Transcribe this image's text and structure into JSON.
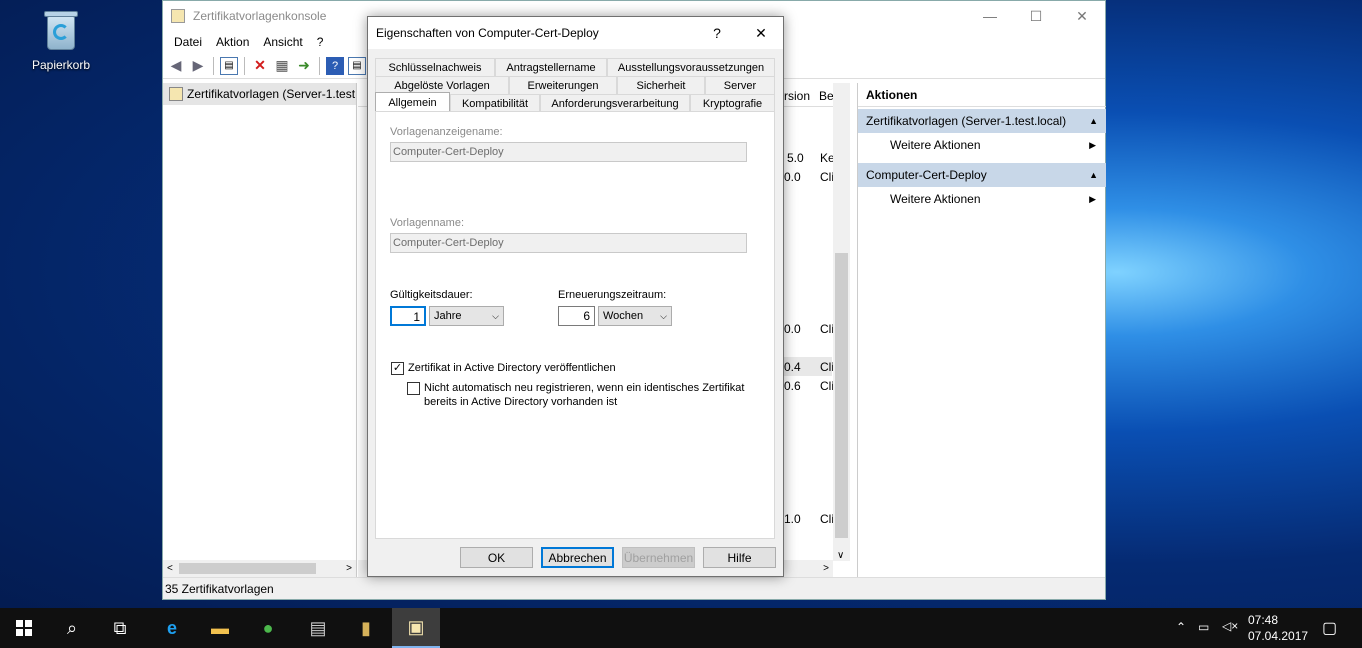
{
  "desktop": {
    "recycle_bin_label": "Papierkorb"
  },
  "console": {
    "title": "Zertifikatvorlagenkonsole",
    "window_buttons": {
      "minimize": "—",
      "maximize": "☐",
      "close": "✕"
    },
    "menu": [
      "Datei",
      "Aktion",
      "Ansicht",
      "?"
    ],
    "tree_node": "Zertifikatvorlagen (Server-1.test.local)",
    "list_headers": {
      "version": "rsion",
      "purpose": "Be"
    },
    "list_fragments": [
      {
        "v": "5.0",
        "p": "Ke"
      },
      {
        "v": "0.0",
        "p": "Cli"
      },
      {
        "v": "0.0",
        "p": "Cli"
      },
      {
        "v": "0.4",
        "p": "Cli"
      },
      {
        "v": "0.6",
        "p": "Cli"
      },
      {
        "v": "1.0",
        "p": "Cli"
      }
    ],
    "status": "35 Zertifikatvorlagen",
    "actions": {
      "header": "Aktionen",
      "section1": "Zertifikatvorlagen (Server-1.test.local)",
      "more1": "Weitere Aktionen",
      "section2": "Computer-Cert-Deploy",
      "more2": "Weitere Aktionen"
    }
  },
  "dialog": {
    "title": "Eigenschaften von Computer-Cert-Deploy",
    "help": "?",
    "close": "✕",
    "tabs_row1": [
      "Schlüsselnachweis",
      "Antragstellername",
      "Ausstellungsvoraussetzungen"
    ],
    "tabs_row2": [
      "Abgelöste Vorlagen",
      "Erweiterungen",
      "Sicherheit",
      "Server"
    ],
    "tabs_row3": [
      "Allgemein",
      "Kompatibilität",
      "Anforderungsverarbeitung",
      "Kryptografie"
    ],
    "display_name_label": "Vorlagenanzeigename:",
    "display_name_value": "Computer-Cert-Deploy",
    "template_name_label": "Vorlagenname:",
    "template_name_value": "Computer-Cert-Deploy",
    "validity_label": "Gültigkeitsdauer:",
    "validity_value": "1",
    "validity_unit": "Jahre",
    "renewal_label": "Erneuerungszeitraum:",
    "renewal_value": "6",
    "renewal_unit": "Wochen",
    "publish_ad_label": "Zertifikat in Active Directory veröffentlichen",
    "publish_ad_checked": true,
    "no_reenroll_label_1": "Nicht automatisch neu registrieren, wenn ein identisches Zertifikat",
    "no_reenroll_label_2": "bereits in Active Directory vorhanden ist",
    "no_reenroll_checked": false,
    "buttons": {
      "ok": "OK",
      "cancel": "Abbrechen",
      "apply": "Übernehmen",
      "help": "Hilfe"
    }
  },
  "taskbar": {
    "time": "07:48",
    "date": "07.04.2017"
  }
}
